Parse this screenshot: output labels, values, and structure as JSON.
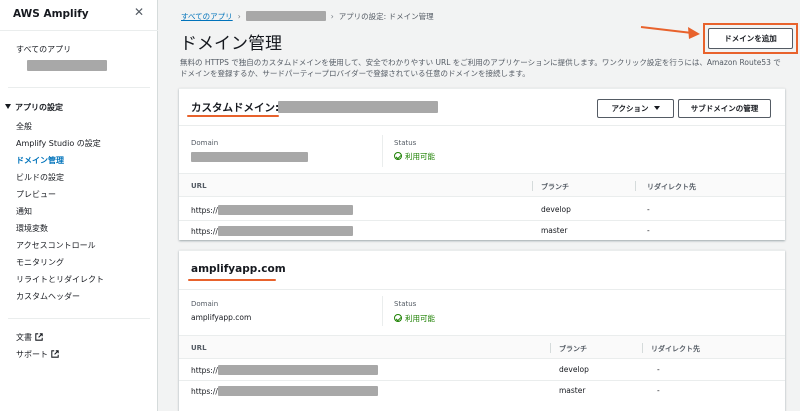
{
  "sidebar": {
    "title": "AWS Amplify",
    "all_apps": "すべてのアプリ",
    "section": "アプリの設定",
    "items": [
      {
        "label": "全般"
      },
      {
        "label": "Amplify Studio の設定"
      },
      {
        "label": "ドメイン管理"
      },
      {
        "label": "ビルドの設定"
      },
      {
        "label": "プレビュー"
      },
      {
        "label": "通知"
      },
      {
        "label": "環境変数"
      },
      {
        "label": "アクセスコントロール"
      },
      {
        "label": "モニタリング"
      },
      {
        "label": "リライトとリダイレクト"
      },
      {
        "label": "カスタムヘッダー"
      }
    ],
    "docs": "文書",
    "support": "サポート",
    "active_color": "#0073bb"
  },
  "breadcrumb": {
    "root": "すべてのアプリ",
    "current": "アプリの設定: ドメイン管理"
  },
  "page": {
    "title": "ドメイン管理",
    "description": "無料の HTTPS で独自のカスタムドメインを使用して、安全でわかりやすい URL をご利用のアプリケーションに提供します。ワンクリック設定を行うには、Amazon Route53 でドメインを登録するか、サードパーティープロバイダーで登録されている任意のドメインを接続します。",
    "add_domain_button": "ドメインを追加"
  },
  "custom_domain": {
    "title_prefix": "カスタムドメイン:",
    "actions_button": "アクション",
    "subdomain_button": "サブドメインの管理",
    "domain_label": "Domain",
    "status_label": "Status",
    "status_value": "利用可能",
    "columns": [
      "URL",
      "ブランチ",
      "リダイレクト先"
    ],
    "rows": [
      {
        "url": "https://",
        "branch": "develop",
        "redirect": "-"
      },
      {
        "url": "https://",
        "branch": "master",
        "redirect": "-"
      }
    ]
  },
  "amplify_domain": {
    "title": "amplifyapp.com",
    "domain_label": "Domain",
    "domain_value": "amplifyapp.com",
    "status_label": "Status",
    "status_value": "利用可能",
    "columns": [
      "URL",
      "ブランチ",
      "リダイレクト先"
    ],
    "rows": [
      {
        "url": "https://",
        "branch": "develop",
        "redirect": "-"
      },
      {
        "url": "https://",
        "branch": "master",
        "redirect": "-"
      }
    ]
  },
  "colors": {
    "accent": "#0073bb",
    "annotation": "#e8622c",
    "success": "#1d8102"
  }
}
